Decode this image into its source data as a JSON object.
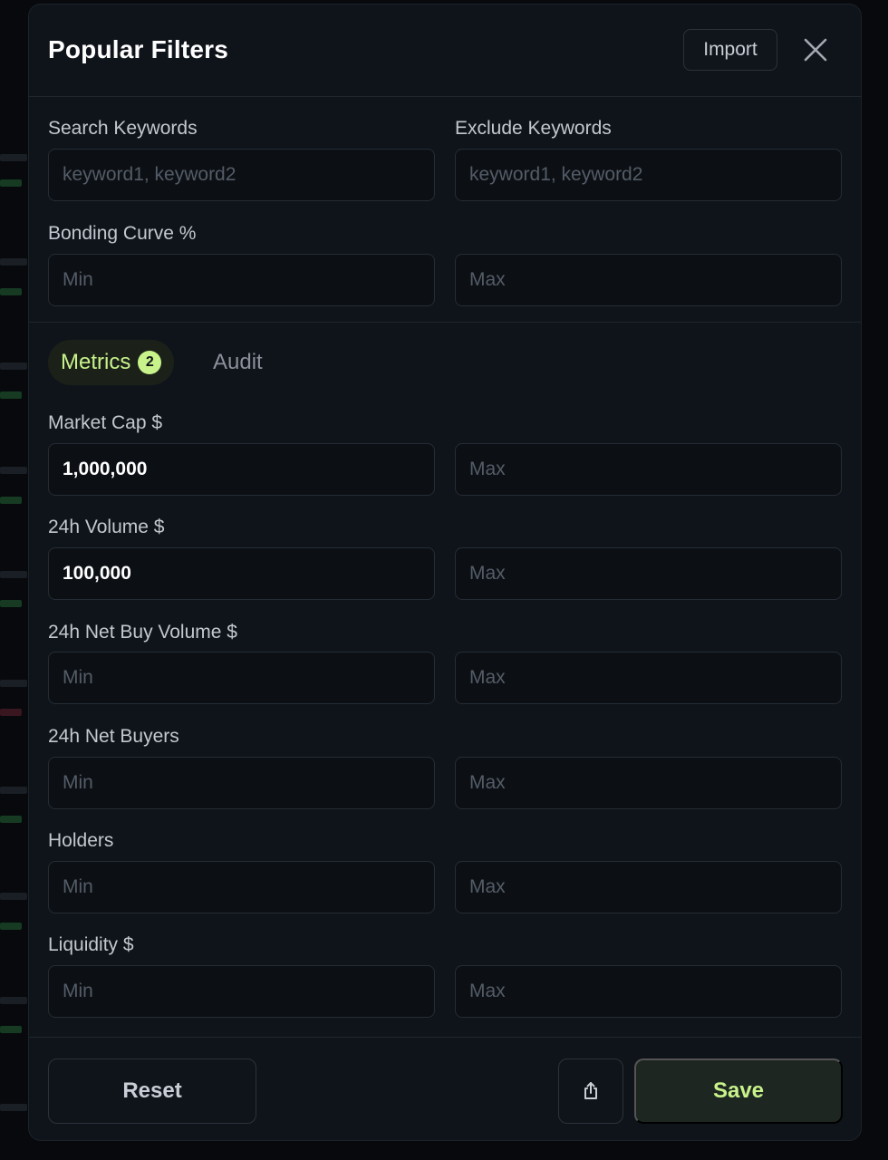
{
  "header": {
    "title": "Popular Filters",
    "import_label": "Import",
    "close_icon": "close-icon"
  },
  "keywords": {
    "search_label": "Search Keywords",
    "search_placeholder": "keyword1, keyword2",
    "search_value": "",
    "exclude_label": "Exclude Keywords",
    "exclude_placeholder": "keyword1, keyword2",
    "exclude_value": ""
  },
  "bonding_curve": {
    "label": "Bonding Curve %",
    "min_placeholder": "Min",
    "max_placeholder": "Max"
  },
  "tabs": {
    "metrics_label": "Metrics",
    "metrics_badge": "2",
    "audit_label": "Audit"
  },
  "metrics": [
    {
      "label": "Market Cap $",
      "min_value": "1,000,000",
      "min_placeholder": "Min",
      "max_value": "",
      "max_placeholder": "Max"
    },
    {
      "label": "24h Volume $",
      "min_value": "100,000",
      "min_placeholder": "Min",
      "max_value": "",
      "max_placeholder": "Max"
    },
    {
      "label": "24h Net Buy Volume $",
      "min_value": "",
      "min_placeholder": "Min",
      "max_value": "",
      "max_placeholder": "Max"
    },
    {
      "label": "24h Net Buyers",
      "min_value": "",
      "min_placeholder": "Min",
      "max_value": "",
      "max_placeholder": "Max"
    },
    {
      "label": "Holders",
      "min_value": "",
      "min_placeholder": "Min",
      "max_value": "",
      "max_placeholder": "Max"
    },
    {
      "label": "Liquidity $",
      "min_value": "",
      "min_placeholder": "Min",
      "max_value": "",
      "max_placeholder": "Max"
    }
  ],
  "footer": {
    "reset_label": "Reset",
    "share_icon": "share-icon",
    "save_label": "Save"
  },
  "colors": {
    "accent": "#c8f28a",
    "background": "#0f141a"
  }
}
